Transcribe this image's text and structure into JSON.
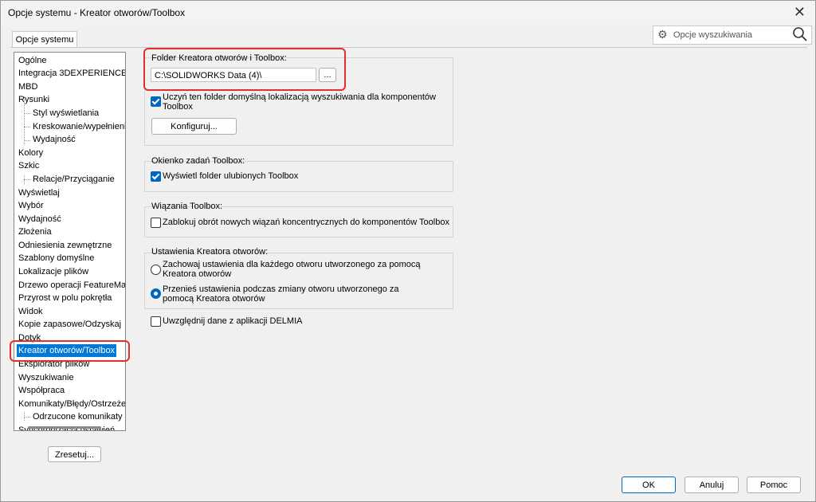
{
  "window": {
    "title": "Opcje systemu - Kreator otworów/Toolbox",
    "close_glyph": "✕"
  },
  "tab": {
    "label": "Opcje systemu"
  },
  "search": {
    "placeholder": "Opcje wyszukiwania",
    "icon_left": "gear-icon",
    "icon_right": "search-icon"
  },
  "tree": {
    "items": [
      {
        "label": "Ogólne"
      },
      {
        "label": "Integracja 3DEXPERIENCE"
      },
      {
        "label": "MBD"
      },
      {
        "label": "Rysunki"
      },
      {
        "label": "Styl wyświetlania"
      },
      {
        "label": "Kreskowanie/wypełnienie"
      },
      {
        "label": "Wydajność"
      },
      {
        "label": "Kolory"
      },
      {
        "label": "Szkic"
      },
      {
        "label": "Relacje/Przyciąganie"
      },
      {
        "label": "Wyświetlaj"
      },
      {
        "label": "Wybór"
      },
      {
        "label": "Wydajność"
      },
      {
        "label": "Złożenia"
      },
      {
        "label": "Odniesienia zewnętrzne"
      },
      {
        "label": "Szablony domyślne"
      },
      {
        "label": "Lokalizacje plików"
      },
      {
        "label": "Drzewo operacji FeatureManager"
      },
      {
        "label": "Przyrost w polu pokrętła"
      },
      {
        "label": "Widok"
      },
      {
        "label": "Kopie zapasowe/Odzyskaj"
      },
      {
        "label": "Dotyk"
      },
      {
        "label": "Kreator otworów/Toolbox"
      },
      {
        "label": "Eksplorator plików"
      },
      {
        "label": "Wyszukiwanie"
      },
      {
        "label": "Współpraca"
      },
      {
        "label": "Komunikaty/Błędy/Ostrzeżenia"
      },
      {
        "label": "Odrzucone komunikaty"
      },
      {
        "label": "Synchronizacja ustawień"
      }
    ]
  },
  "reset_button": "Zresetuj...",
  "folder_group": {
    "label": "Folder Kreatora otworów i Toolbox:",
    "path_value": "C:\\SOLIDWORKS Data (4)\\",
    "browse_label": "...",
    "checkbox_label": "Uczyń ten folder domyślną lokalizacją wyszukiwania dla komponentów Toolbox",
    "checkbox_checked": true,
    "configure_label": "Konfiguruj..."
  },
  "taskpane_group": {
    "label": "Okienko zadań Toolbox:",
    "checkbox_label": "Wyświetl folder ulubionych Toolbox",
    "checkbox_checked": true
  },
  "mates_group": {
    "label": "Wiązania Toolbox:",
    "checkbox_label": "Zablokuj obrót nowych wiązań koncentrycznych do komponentów Toolbox",
    "checkbox_checked": false
  },
  "hole_group": {
    "label": "Ustawienia Kreatora otworów:",
    "radio1_label": "Zachowaj ustawienia dla każdego otworu utworzonego za pomocą Kreatora otworów",
    "radio2_label": "Przenieś ustawienia podczas zmiany otworu utworzonego za pomocą Kreatora otworów",
    "selected": 2
  },
  "delmia": {
    "checkbox_label": "Uwzględnij dane z aplikacji DELMIA",
    "checkbox_checked": false
  },
  "footer": {
    "ok": "OK",
    "cancel": "Anuluj",
    "help": "Pomoc"
  },
  "colors": {
    "selection": "#0078d7",
    "highlight_box": "#e03030",
    "accent": "#0067c0"
  }
}
